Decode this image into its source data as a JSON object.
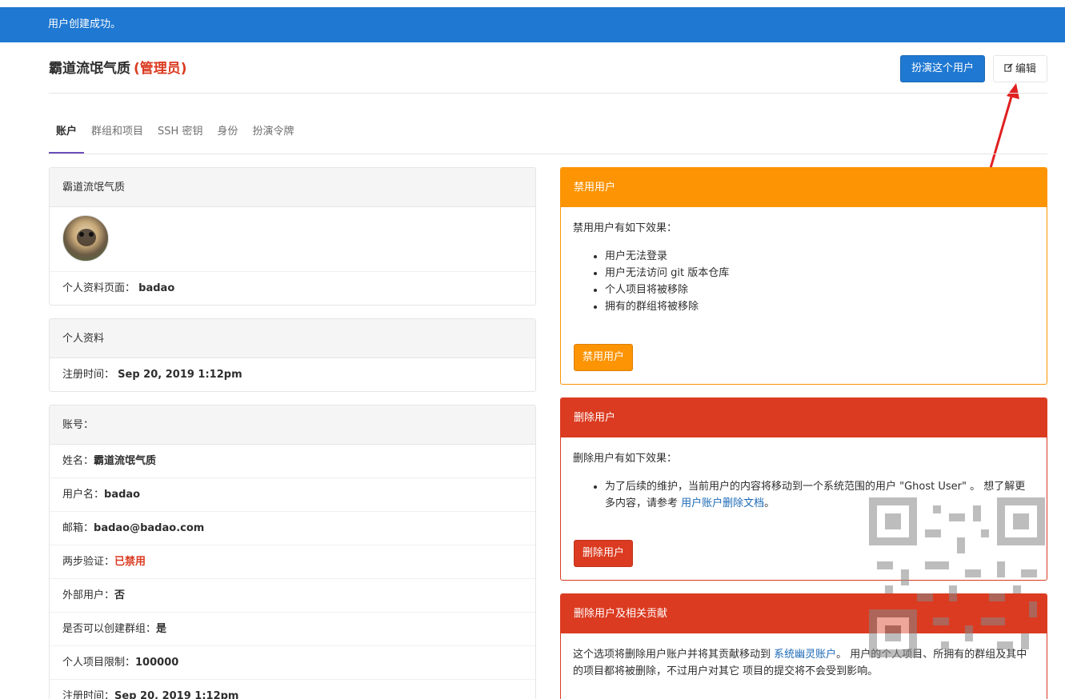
{
  "flash": {
    "message": "用户创建成功。"
  },
  "header": {
    "title": "霸道流氓气质",
    "admin_tag": "(管理员)",
    "impersonate_label": "扮演这个用户",
    "edit_label": "编辑"
  },
  "tabs": [
    {
      "label": "账户"
    },
    {
      "label": "群组和项目"
    },
    {
      "label": "SSH 密钥"
    },
    {
      "label": "身份"
    },
    {
      "label": "扮演令牌"
    }
  ],
  "profile_card": {
    "title": "霸道流氓气质",
    "profile_page_label": "个人资料页面：",
    "profile_page_value": "badao"
  },
  "personal_card": {
    "title": "个人资料",
    "registered_label": "注册时间：",
    "registered_value": "Sep 20, 2019 1:12pm"
  },
  "account_card": {
    "title": "账号：",
    "rows": [
      {
        "label": "姓名：",
        "value": "霸道流氓气质"
      },
      {
        "label": "用户名：",
        "value": "badao"
      },
      {
        "label": "邮箱：",
        "value": "badao@badao.com"
      },
      {
        "label": "两步验证：",
        "value": "已禁用"
      },
      {
        "label": "外部用户：",
        "value": "否"
      },
      {
        "label": "是否可以创建群组：",
        "value": "是"
      },
      {
        "label": "个人项目限制：",
        "value": "100000"
      },
      {
        "label": "注册时间：",
        "value": "Sep 20, 2019 1:12pm"
      }
    ]
  },
  "block_card": {
    "title": "禁用用户",
    "intro": "禁用用户有如下效果：",
    "effects": [
      "用户无法登录",
      "用户无法访问 git 版本仓库",
      "个人项目将被移除",
      "拥有的群组将被移除"
    ],
    "button": "禁用用户"
  },
  "delete_card": {
    "title": "删除用户",
    "intro": "删除用户有如下效果：",
    "effect_text": "为了后续的维护，当前用户的内容将移动到一个系统范围的用户 \"Ghost User\" 。 想了解更多内容，请参考 ",
    "effect_link": "用户账户删除文档",
    "effect_end": "。",
    "button": "删除用户"
  },
  "delete_contrib_card": {
    "title": "删除用户及相关贡献",
    "text_before": "这个选项将删除用户账户并将其贡献移动到 ",
    "link": "系统幽灵账户",
    "text_after": "。 用户的个人项目、所拥有的群组及其中的项目都将被删除，不过用户对其它 项目的提交将不会受到影响。"
  },
  "colors": {
    "primary": "#1f78d1",
    "warning": "#fc9403",
    "danger": "#db3b21",
    "tab_active": "#6b4fbb"
  }
}
